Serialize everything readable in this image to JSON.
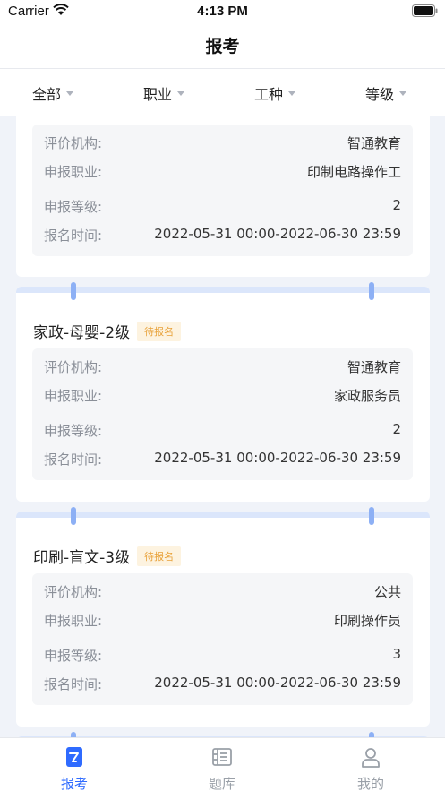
{
  "status_bar": {
    "carrier": "Carrier",
    "time": "4:13 PM"
  },
  "nav": {
    "title": "报考"
  },
  "filters": [
    {
      "label": "全部"
    },
    {
      "label": "职业"
    },
    {
      "label": "工种"
    },
    {
      "label": "等级"
    }
  ],
  "labels": {
    "org": "评价机构:",
    "occupation": "申报职业:",
    "level": "申报等级:",
    "time": "报名时间:"
  },
  "cards": [
    {
      "title": "",
      "status": "",
      "org": "智通教育",
      "occupation": "印制电路操作工",
      "level": "2",
      "time": "2022-05-31 00:00-2022-06-30 23:59"
    },
    {
      "title": "家政-母婴-2级",
      "status": "待报名",
      "org": "智通教育",
      "occupation": "家政服务员",
      "level": "2",
      "time": "2022-05-31 00:00-2022-06-30 23:59"
    },
    {
      "title": "印刷-盲文-3级",
      "status": "待报名",
      "org": "公共",
      "occupation": "印刷操作员",
      "level": "3",
      "time": "2022-05-31 00:00-2022-06-30 23:59"
    }
  ],
  "tabbar": {
    "items": [
      {
        "label": "报考",
        "icon": "exam-icon",
        "active": true
      },
      {
        "label": "题库",
        "icon": "question-bank-icon",
        "active": false
      },
      {
        "label": "我的",
        "icon": "profile-icon",
        "active": false
      }
    ]
  },
  "colors": {
    "accent": "#2f6bff",
    "badge_text": "#e8a23a",
    "badge_bg": "#fdf3e0",
    "inactive": "#9aa0a8"
  }
}
